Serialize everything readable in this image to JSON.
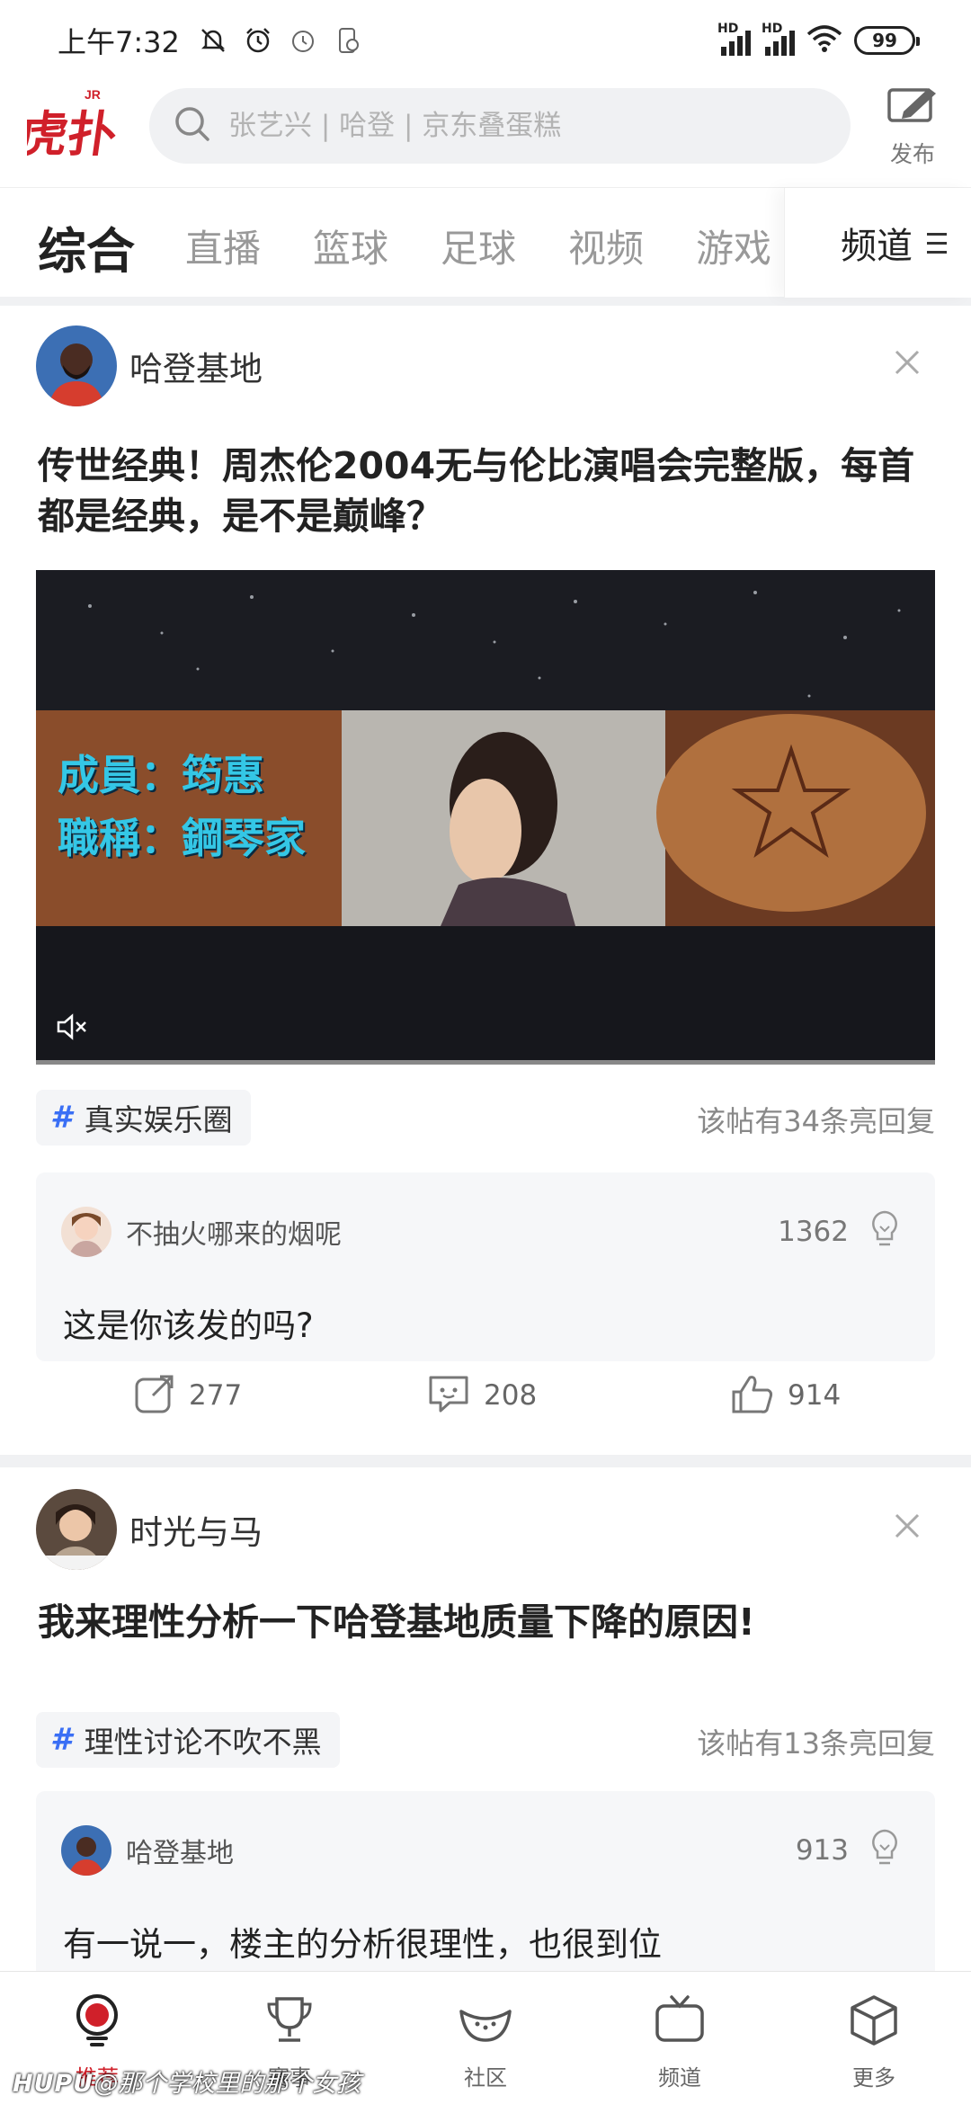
{
  "status_bar": {
    "time": "上午7:32",
    "hd1": "HD",
    "hd2": "HD",
    "battery": "99"
  },
  "header": {
    "search_placeholder": "张艺兴 | 哈登 | 京东叠蛋糕",
    "publish_label": "发布",
    "brand_color": "#d0202a"
  },
  "tabs": {
    "items": [
      "综合",
      "直播",
      "篮球",
      "足球",
      "视频",
      "游戏"
    ],
    "active_index": 0,
    "channel_label": "频道"
  },
  "feed": [
    {
      "author": "哈登基地",
      "title": "传世经典！周杰伦2004无与伦比演唱会完整版，每首都是经典，是不是巅峰？",
      "video": {
        "subtitle_line1": "成員：筠惠",
        "subtitle_line2": "職稱：鋼琴家",
        "muted": true
      },
      "topic": "真实娱乐圈",
      "reply_count_text": "该帖有34条亮回复",
      "hot_reply": {
        "user": "不抽火哪来的烟呢",
        "likes": "1362",
        "text": "这是你该发的吗?"
      },
      "actions": {
        "share": "277",
        "comments": "208",
        "likes": "914"
      }
    },
    {
      "author": "时光与马",
      "title": "我来理性分析一下哈登基地质量下降的原因!",
      "topic": "理性讨论不吹不黑",
      "reply_count_text": "该帖有13条亮回复",
      "hot_reply": {
        "user": "哈登基地",
        "likes": "913",
        "text": "有一说一，楼主的分析很理性，也很到位"
      }
    }
  ],
  "bottom_nav": {
    "items": [
      {
        "label": "推荐",
        "icon": "recommend-icon",
        "active": true
      },
      {
        "label": "赛事",
        "icon": "trophy-icon",
        "active": false
      },
      {
        "label": "社区",
        "icon": "watermelon-icon",
        "active": false
      },
      {
        "label": "频道",
        "icon": "tv-icon",
        "active": false
      },
      {
        "label": "更多",
        "icon": "cube-icon",
        "active": false
      }
    ]
  },
  "watermark": {
    "brand": "HUPU",
    "text": "@那个学校里的那个女孩"
  }
}
